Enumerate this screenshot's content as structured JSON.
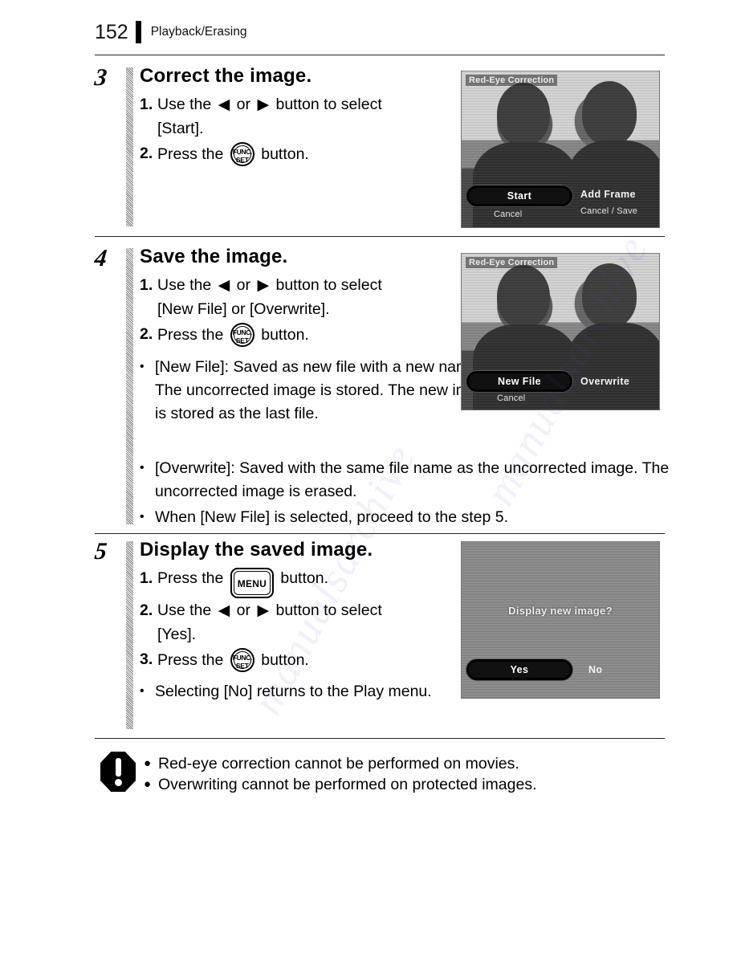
{
  "header": {
    "page_number": "152",
    "title": "Playback/Erasing"
  },
  "steps": [
    {
      "number": "3",
      "title": "Correct the image.",
      "substeps": [
        {
          "marker": "1.",
          "pre": "Use the",
          "post": "button to select",
          "cont": "[Start]."
        },
        {
          "marker": "2.",
          "pre": "Press the",
          "post": "button."
        }
      ],
      "screen": {
        "title": "Red-Eye Correction",
        "selected_option": "Start",
        "right_option_line1": "Add Frame",
        "right_option_line2": "Cancel / Save",
        "sub_label": "Cancel"
      }
    },
    {
      "number": "4",
      "title": "Save the image.",
      "substeps": [
        {
          "marker": "1.",
          "pre": "Use the",
          "post": "button to select",
          "cont": "[New File] or [Overwrite]."
        },
        {
          "marker": "2.",
          "pre": "Press the",
          "post": "button."
        }
      ],
      "bullets": [
        "[New File]: Saved as new file with a new name. The uncorrected image is stored. The new image is stored as the last file.",
        "[Overwrite]: Saved with the same file name as the uncorrected image. The uncorrected image is erased.",
        "When [New File] is selected, proceed to the step 5."
      ],
      "screen": {
        "title": "Red-Eye Correction",
        "selected_option": "New File",
        "right_option_line1": "Overwrite",
        "sub_label": "Cancel"
      }
    },
    {
      "number": "5",
      "title": "Display the saved image.",
      "substeps": [
        {
          "marker": "1.",
          "pre": "Press the",
          "post": "button.",
          "icon": "menu"
        },
        {
          "marker": "2.",
          "pre": "Use the",
          "post": "button to select",
          "cont": "[Yes]."
        },
        {
          "marker": "3.",
          "pre": "Press the",
          "post": "button.",
          "icon": "funcset"
        }
      ],
      "bullets": [
        "Selecting [No] returns to the Play menu."
      ],
      "screen": {
        "center_label": "Display new image?",
        "selected_option": "Yes",
        "right_option_line1": "No"
      }
    }
  ],
  "notes": [
    "Red-eye correction cannot be performed on movies.",
    "Overwriting cannot be performed on protected images."
  ],
  "icons": {
    "arrow_left": "◀",
    "arrow_right": "▶",
    "bullet_dot": "●",
    "funcset_line1": "FUNC.",
    "funcset_line2": "SET",
    "menu_label": "MENU"
  },
  "watermark": {
    "line1": "manualsarchive",
    "line2": "manualsarchive"
  }
}
